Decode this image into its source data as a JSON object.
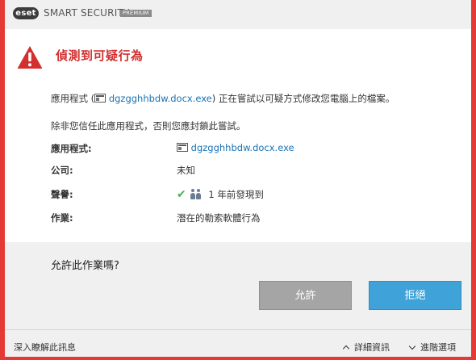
{
  "titlebar": {
    "logo_text": "eset",
    "product_name": "SMART SECURITY",
    "edition": "PREMIUM"
  },
  "alert": {
    "icon": "warning-triangle-icon",
    "headline": "偵測到可疑行為",
    "message_prefix": "應用程式 (",
    "message_app": "dgzgghhbdw.docx.exe",
    "message_suffix": ") 正在嘗試以可疑方式修改您電腦上的檔案。",
    "message_2": "除非您信任此應用程式，否則您應封鎖此嘗試。"
  },
  "details": {
    "app_label": "應用程式:",
    "app_value": "dgzgghhbdw.docx.exe",
    "company_label": "公司:",
    "company_value": "未知",
    "reputation_label": "聲譽:",
    "reputation_value": "1 年前發現到",
    "operation_label": "作業:",
    "operation_value": "潛在的勒索軟體行為"
  },
  "prompt": {
    "question": "允許此作業嗎?",
    "allow_label": "允許",
    "deny_label": "拒絕"
  },
  "footer": {
    "learn_more": "深入瞭解此訊息",
    "details": "詳細資訊",
    "advanced": "進階選項"
  },
  "colors": {
    "frame": "#e53935",
    "headline": "#d32f2f",
    "link": "#1a73b5",
    "allow_button": "#a5a5a5",
    "deny_button": "#3fa2d8"
  }
}
